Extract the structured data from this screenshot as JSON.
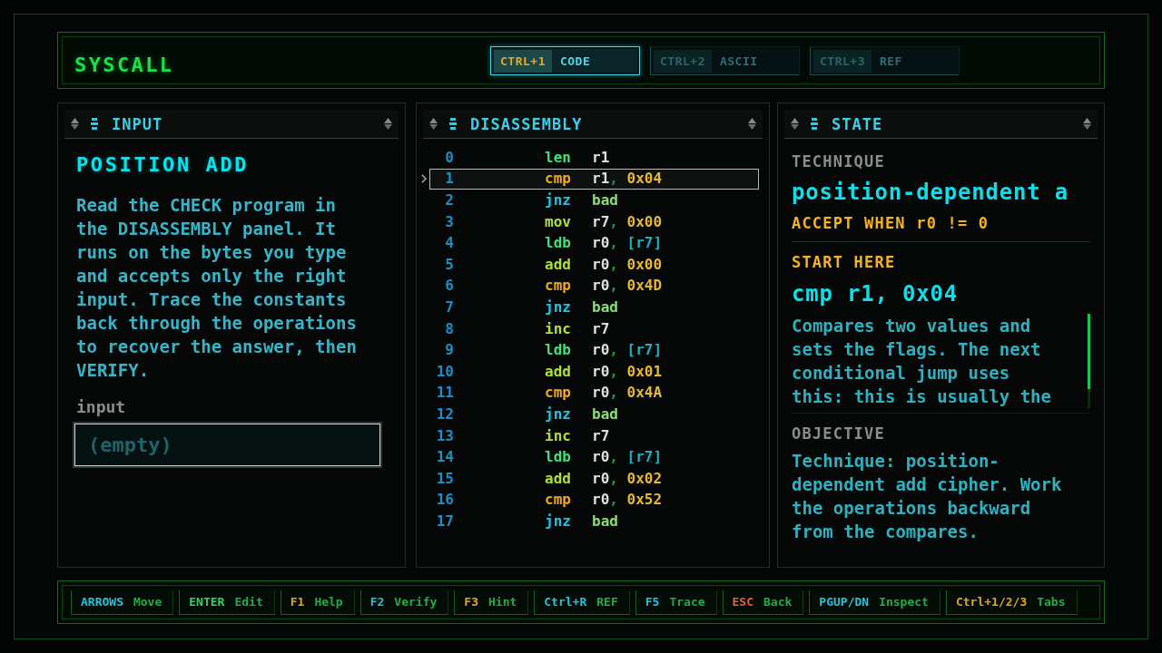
{
  "header": {
    "title": "SYSCALL",
    "tabs": [
      {
        "key": "CTRL+1",
        "label": "CODE",
        "selected": true
      },
      {
        "key": "CTRL+2",
        "label": "ASCII",
        "selected": false
      },
      {
        "key": "CTRL+3",
        "label": "REF",
        "selected": false
      }
    ]
  },
  "input_panel": {
    "heading": "INPUT",
    "title": "POSITION ADD",
    "instructions": "Read the CHECK program in the DISASSEMBLY panel. It runs on the bytes you type and accepts only the right input. Trace the constants back through the operations to recover the answer, then VERIFY.",
    "field_label": "input",
    "field": {
      "placeholder": "(empty)"
    }
  },
  "disassembly_panel": {
    "heading": "DISASSEMBLY",
    "rows": [
      {
        "index": "0",
        "kind": "load",
        "mnemonic": "len",
        "selected": false,
        "operands": [
          {
            "text": "r1",
            "kind": "register"
          }
        ]
      },
      {
        "index": "1",
        "kind": "compare",
        "mnemonic": "cmp",
        "selected": true,
        "operands": [
          {
            "text": "r1",
            "kind": "register"
          },
          {
            "text": ", ",
            "kind": "punct"
          },
          {
            "text": "0x04",
            "kind": "immediate"
          }
        ]
      },
      {
        "index": "2",
        "kind": "branch",
        "mnemonic": "jnz",
        "selected": false,
        "operands": [
          {
            "text": "bad",
            "kind": "label"
          }
        ]
      },
      {
        "index": "3",
        "kind": "arith",
        "mnemonic": "mov",
        "selected": false,
        "operands": [
          {
            "text": "r7",
            "kind": "register"
          },
          {
            "text": ", ",
            "kind": "punct"
          },
          {
            "text": "0x00",
            "kind": "immediate"
          }
        ]
      },
      {
        "index": "4",
        "kind": "load",
        "mnemonic": "ldb",
        "selected": false,
        "operands": [
          {
            "text": "r0",
            "kind": "register"
          },
          {
            "text": ", ",
            "kind": "punct"
          },
          {
            "text": "[r7]",
            "kind": "memory"
          }
        ]
      },
      {
        "index": "5",
        "kind": "arith",
        "mnemonic": "add",
        "selected": false,
        "operands": [
          {
            "text": "r0",
            "kind": "register"
          },
          {
            "text": ", ",
            "kind": "punct"
          },
          {
            "text": "0x00",
            "kind": "immediate"
          }
        ]
      },
      {
        "index": "6",
        "kind": "compare",
        "mnemonic": "cmp",
        "selected": false,
        "operands": [
          {
            "text": "r0",
            "kind": "register"
          },
          {
            "text": ", ",
            "kind": "punct"
          },
          {
            "text": "0x4D",
            "kind": "immediate"
          }
        ]
      },
      {
        "index": "7",
        "kind": "branch",
        "mnemonic": "jnz",
        "selected": false,
        "operands": [
          {
            "text": "bad",
            "kind": "label"
          }
        ]
      },
      {
        "index": "8",
        "kind": "arith",
        "mnemonic": "inc",
        "selected": false,
        "operands": [
          {
            "text": "r7",
            "kind": "register"
          }
        ]
      },
      {
        "index": "9",
        "kind": "load",
        "mnemonic": "ldb",
        "selected": false,
        "operands": [
          {
            "text": "r0",
            "kind": "register"
          },
          {
            "text": ", ",
            "kind": "punct"
          },
          {
            "text": "[r7]",
            "kind": "memory"
          }
        ]
      },
      {
        "index": "10",
        "kind": "arith",
        "mnemonic": "add",
        "selected": false,
        "operands": [
          {
            "text": "r0",
            "kind": "register"
          },
          {
            "text": ", ",
            "kind": "punct"
          },
          {
            "text": "0x01",
            "kind": "immediate"
          }
        ]
      },
      {
        "index": "11",
        "kind": "compare",
        "mnemonic": "cmp",
        "selected": false,
        "operands": [
          {
            "text": "r0",
            "kind": "register"
          },
          {
            "text": ", ",
            "kind": "punct"
          },
          {
            "text": "0x4A",
            "kind": "immediate"
          }
        ]
      },
      {
        "index": "12",
        "kind": "branch",
        "mnemonic": "jnz",
        "selected": false,
        "operands": [
          {
            "text": "bad",
            "kind": "label"
          }
        ]
      },
      {
        "index": "13",
        "kind": "arith",
        "mnemonic": "inc",
        "selected": false,
        "operands": [
          {
            "text": "r7",
            "kind": "register"
          }
        ]
      },
      {
        "index": "14",
        "kind": "load",
        "mnemonic": "ldb",
        "selected": false,
        "operands": [
          {
            "text": "r0",
            "kind": "register"
          },
          {
            "text": ", ",
            "kind": "punct"
          },
          {
            "text": "[r7]",
            "kind": "memory"
          }
        ]
      },
      {
        "index": "15",
        "kind": "arith",
        "mnemonic": "add",
        "selected": false,
        "operands": [
          {
            "text": "r0",
            "kind": "register"
          },
          {
            "text": ", ",
            "kind": "punct"
          },
          {
            "text": "0x02",
            "kind": "immediate"
          }
        ]
      },
      {
        "index": "16",
        "kind": "compare",
        "mnemonic": "cmp",
        "selected": false,
        "operands": [
          {
            "text": "r0",
            "kind": "register"
          },
          {
            "text": ", ",
            "kind": "punct"
          },
          {
            "text": "0x52",
            "kind": "immediate"
          }
        ]
      },
      {
        "index": "17",
        "kind": "branch",
        "mnemonic": "jnz",
        "selected": false,
        "operands": [
          {
            "text": "bad",
            "kind": "label"
          }
        ]
      }
    ]
  },
  "state_panel": {
    "heading": "STATE",
    "technique_label": "TECHNIQUE",
    "technique": "position-dependent a",
    "accept_condition": "ACCEPT WHEN r0 != 0",
    "start_label": "START HERE",
    "start_instruction": "cmp r1, 0x04",
    "start_description": "Compares two values and sets the flags. The next conditional jump uses this: this is usually the",
    "objective_label": "OBJECTIVE",
    "objective": "Technique: position-dependent add cipher. Work the operations backward from the compares."
  },
  "status_bar": {
    "hints": [
      {
        "key": "ARROWS",
        "action": "Move",
        "color": "#22c4dc"
      },
      {
        "key": "ENTER",
        "action": "Edit",
        "color": "#34d266"
      },
      {
        "key": "F1",
        "action": "Help",
        "color": "#e6a423"
      },
      {
        "key": "F2",
        "action": "Verify",
        "color": "#22c4dc"
      },
      {
        "key": "F3",
        "action": "Hint",
        "color": "#e6a423"
      },
      {
        "key": "Ctrl+R",
        "action": "REF",
        "color": "#22c4dc"
      },
      {
        "key": "F5",
        "action": "Trace",
        "color": "#22c4dc"
      },
      {
        "key": "ESC",
        "action": "Back",
        "color": "#e0643c"
      },
      {
        "key": "PGUP/DN",
        "action": "Inspect",
        "color": "#22c4dc"
      },
      {
        "key": "Ctrl+1/2/3",
        "action": "Tabs",
        "color": "#e6a423"
      }
    ]
  }
}
